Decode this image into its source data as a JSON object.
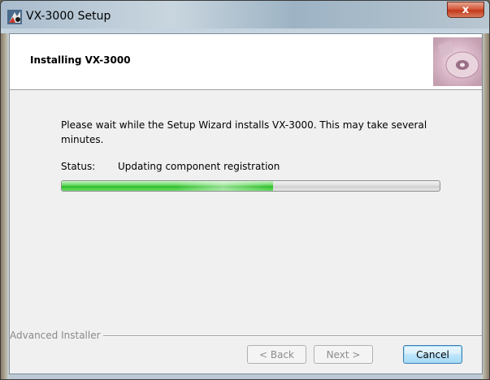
{
  "window": {
    "title": "VX-3000 Setup",
    "close_label": "x"
  },
  "header": {
    "title": "Installing VX-3000"
  },
  "body": {
    "message": "Please wait while the Setup Wizard installs VX-3000.  This may take several minutes.",
    "status_label": "Status:",
    "status_value": "Updating component registration",
    "progress": 0.56
  },
  "footer": {
    "brand": "Advanced Installer",
    "back_label": "< Back",
    "next_label": "Next >",
    "cancel_label": "Cancel"
  },
  "colors": {
    "progress_green": "#3cc436",
    "default_button_border": "#3c7fb1"
  }
}
